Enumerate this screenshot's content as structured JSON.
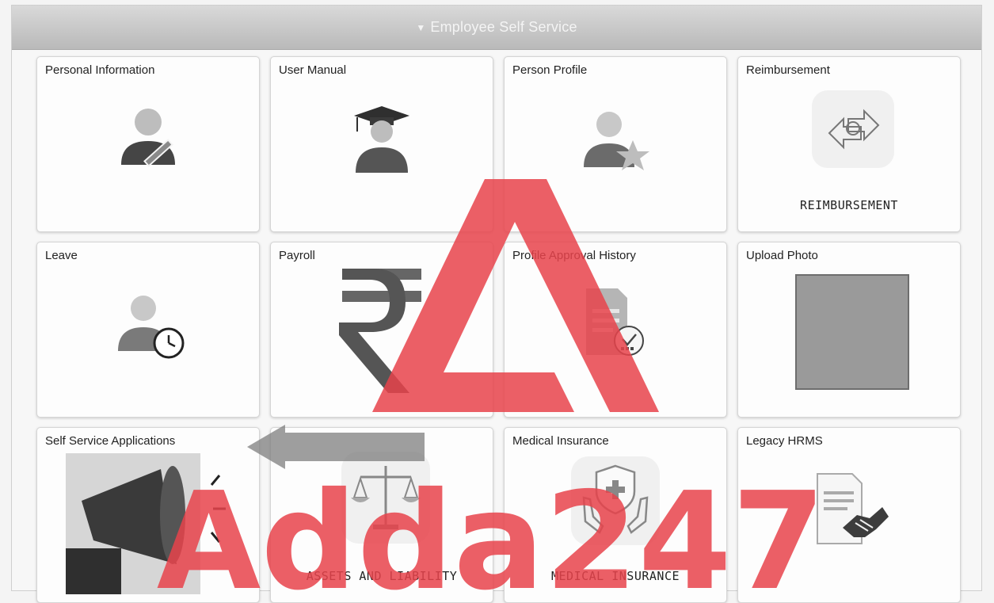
{
  "header": {
    "title": "Employee Self Service",
    "collapse_icon": "triangle-down-icon"
  },
  "tiles": [
    {
      "title": "Personal Information",
      "icon": "person-edit-icon"
    },
    {
      "title": "User Manual",
      "icon": "graduate-icon"
    },
    {
      "title": "Person Profile",
      "icon": "person-star-icon"
    },
    {
      "title": "Reimbursement",
      "icon": "reimbursement-exchange-icon",
      "caption": "REIMBURSEMENT"
    },
    {
      "title": "Leave",
      "icon": "person-clock-icon"
    },
    {
      "title": "Payroll",
      "icon": "rupee-icon"
    },
    {
      "title": "Profile Approval History",
      "icon": "document-check-icon"
    },
    {
      "title": "Upload Photo",
      "icon": "photo-placeholder-icon"
    },
    {
      "title": "Self Service Applications",
      "icon": "megaphone-icon"
    },
    {
      "title": "",
      "icon": "scales-icon",
      "caption": "ASSETS AND LIABILITY"
    },
    {
      "title": "Medical Insurance",
      "icon": "shield-hands-icon",
      "caption": "MEDICAL INSURANCE"
    },
    {
      "title": "Legacy HRMS",
      "icon": "document-handshake-icon"
    }
  ],
  "watermark": {
    "text": "Adda247",
    "color": "#e8434b"
  }
}
